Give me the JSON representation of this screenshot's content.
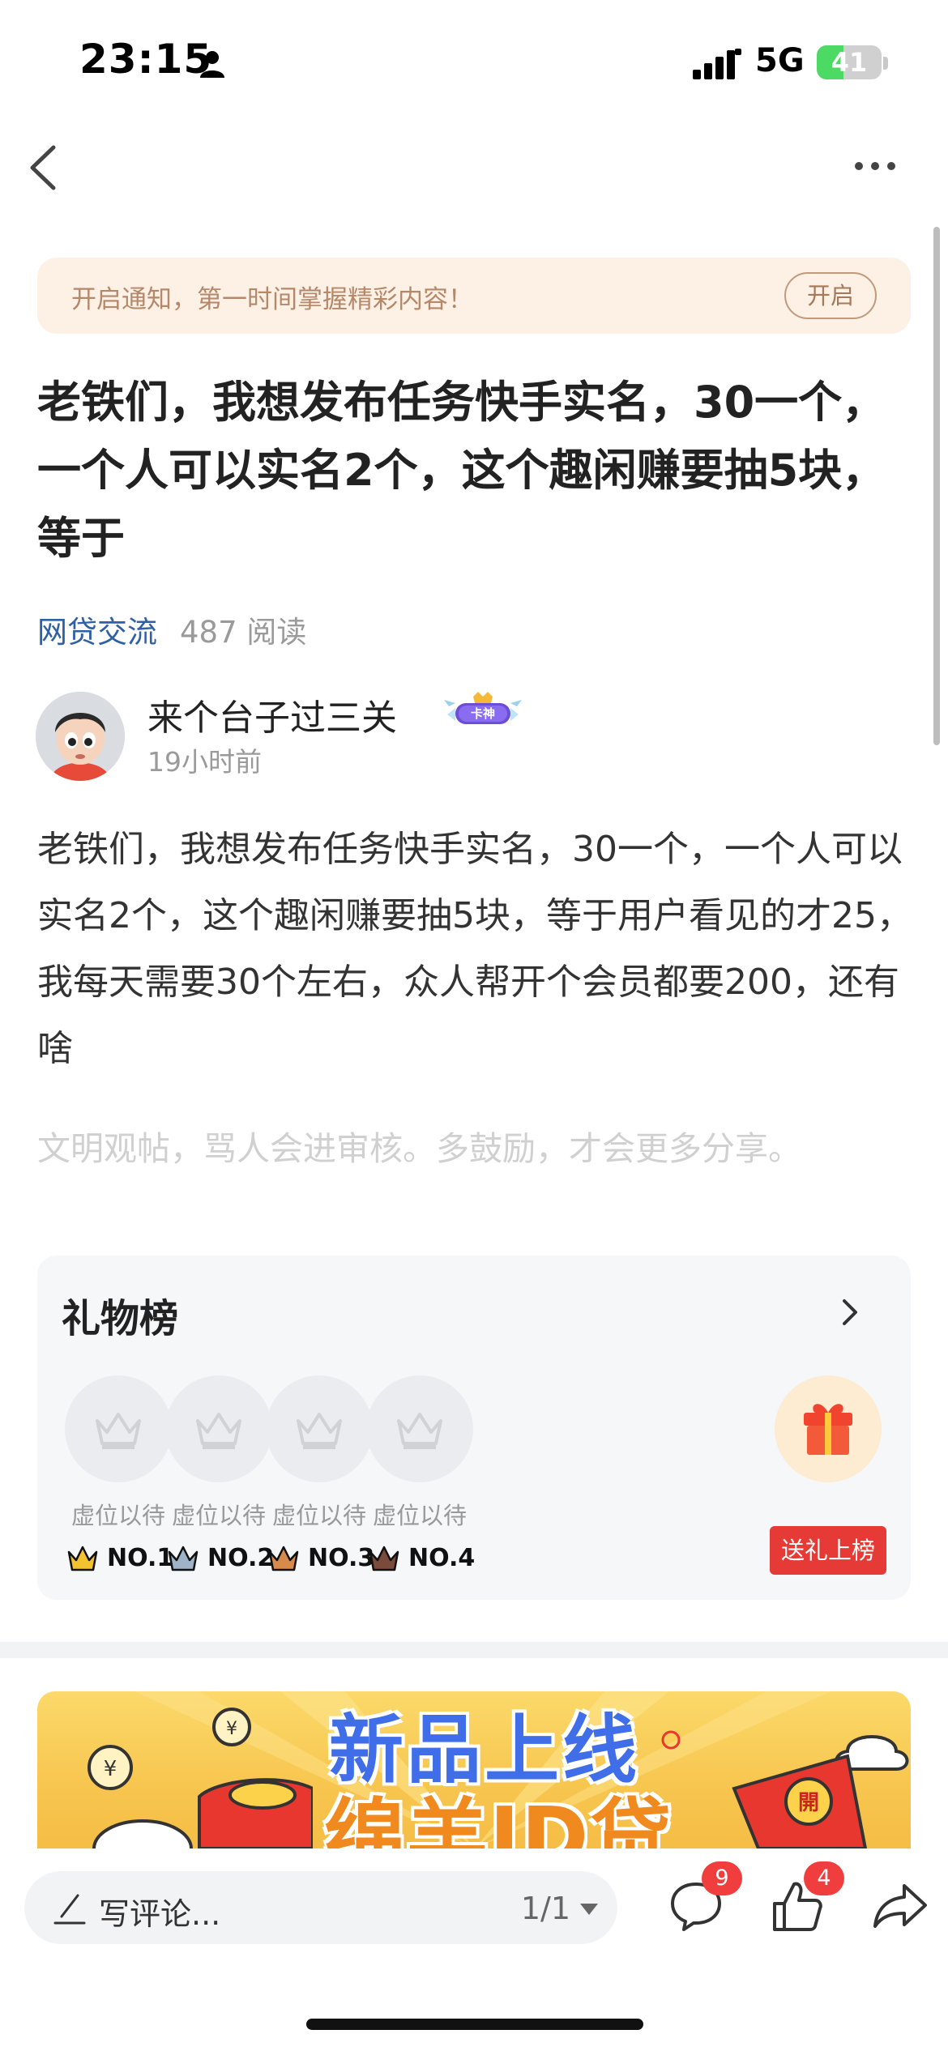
{
  "status_bar": {
    "time": "23:15",
    "network": "5G",
    "battery_level": 41,
    "battery_text": "41"
  },
  "notice": {
    "text": "开启通知，第一时间掌握精彩内容！",
    "button_label": "开启"
  },
  "post": {
    "title": "老铁们，我想发布任务快手实名，30一个，一个人可以实名2个，这个趣闲赚要抽5块，等于",
    "topic": "网贷交流",
    "reads": "487 阅读",
    "author": {
      "name": "来个台子过三关",
      "badge": "卡神",
      "time": "19小时前"
    },
    "body": "老铁们，我想发布任务快手实名，30一个，一个人可以实名2个，这个趣闲赚要抽5块，等于用户看见的才25，我每天需要30个左右，众人帮开个会员都要200，还有啥",
    "civility_note": "文明观帖，骂人会进审核。多鼓励，才会更多分享。"
  },
  "gift_board": {
    "title": "礼物榜",
    "slots": [
      {
        "label": "虚位以待",
        "rank": "NO.1",
        "crown_color": "#f2c230"
      },
      {
        "label": "虚位以待",
        "rank": "NO.2",
        "crown_color": "#9fb3c8"
      },
      {
        "label": "虚位以待",
        "rank": "NO.3",
        "crown_color": "#d88a4a"
      },
      {
        "label": "虚位以待",
        "rank": "NO.4",
        "crown_color": "#7a4a3a"
      }
    ],
    "send_label": "送礼上榜"
  },
  "banner": {
    "line1": "新品上线",
    "line2": "绵羊ID贷"
  },
  "bottom_bar": {
    "comment_placeholder": "写评论...",
    "page_indicator": "1/1",
    "comment_count": "9",
    "like_count": "4"
  },
  "colors": {
    "accent_red": "#e53a36",
    "topic_blue": "#2f5fa4",
    "notice_bg": "#fdf1e6"
  }
}
